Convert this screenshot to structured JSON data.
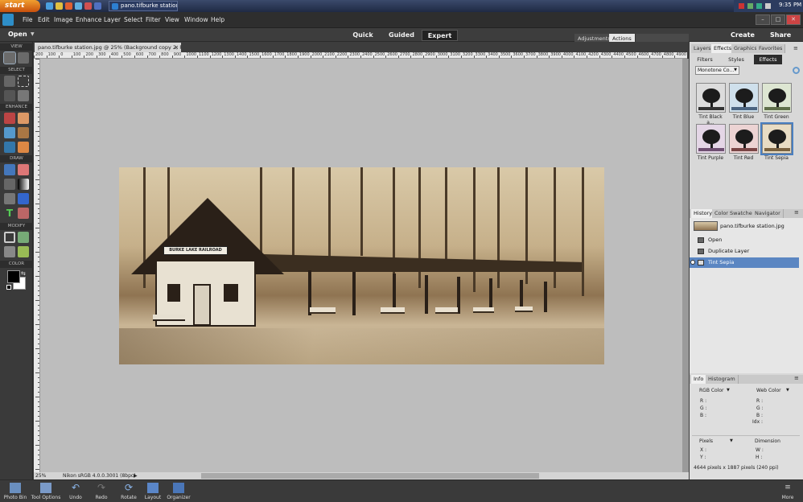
{
  "taskbar": {
    "start_label": "start",
    "task_button_label": "pano.tifburke station...",
    "clock": "9:35 PM"
  },
  "menubar": {
    "items": [
      "File",
      "Edit",
      "Image",
      "Enhance",
      "Layer",
      "Select",
      "Filter",
      "View",
      "Window",
      "Help"
    ]
  },
  "modebar": {
    "open_label": "Open",
    "modes": [
      "Quick",
      "Guided",
      "Expert"
    ],
    "active_mode": "Expert",
    "create_label": "Create",
    "share_label": "Share",
    "panel_tabs": [
      "Adjustments",
      "Actions"
    ]
  },
  "toolbox": {
    "sections": [
      "VIEW",
      "SELECT",
      "ENHANCE",
      "DRAW",
      "MODIFY",
      "COLOR"
    ],
    "foreground_color": "#000000",
    "background_color": "#ffffff"
  },
  "document": {
    "tab_title": "pano.tifburke station.jpg @ 25% (Background copy 2, RGB/8) *",
    "ruler_labels": [
      "200",
      "100",
      "0",
      "100",
      "200",
      "300",
      "400",
      "500",
      "600",
      "700",
      "800",
      "900",
      "1000",
      "1100",
      "1200",
      "1300",
      "1400",
      "1500",
      "1600",
      "1700",
      "1800",
      "1900",
      "2000",
      "2100",
      "2200",
      "2300",
      "2400",
      "2500",
      "2600",
      "2700",
      "2800",
      "2900",
      "3000",
      "3100",
      "3200",
      "3300",
      "3400",
      "3500",
      "3600",
      "3700",
      "3800",
      "3900",
      "4000",
      "4100",
      "4200",
      "4300",
      "4400",
      "4500",
      "4600",
      "4700",
      "4800",
      "4900"
    ],
    "zoom": "25%",
    "profile": "Nikon sRGB 4.0.0.3001 (8bpc)",
    "sign_text": "BURKE LAKE RAILROAD"
  },
  "panels": {
    "top_tabs": [
      "Layers",
      "Effects",
      "Graphics",
      "Favorites"
    ],
    "active_top_tab": "Effects",
    "sub_tabs": [
      "Filters",
      "Styles",
      "Effects"
    ],
    "active_sub_tab": "Effects",
    "effects_dropdown": "Monotone Co...",
    "effects": [
      {
        "label": "Tint Black a...",
        "tint": "#dcdcdc",
        "ground": "#333333"
      },
      {
        "label": "Tint Blue",
        "tint": "#cfe0ec",
        "ground": "#4a6480"
      },
      {
        "label": "Tint Green",
        "tint": "#dde6d2",
        "ground": "#5f6f4a"
      },
      {
        "label": "Tint Purple",
        "tint": "#e4d6e6",
        "ground": "#6f4f72"
      },
      {
        "label": "Tint Red",
        "tint": "#ecd3d3",
        "ground": "#7a4545"
      },
      {
        "label": "Tint Sepia",
        "tint": "#e8dcc4",
        "ground": "#7a6240"
      }
    ],
    "selected_effect": "Tint Sepia",
    "history_tabs": [
      "History",
      "Color Swatches",
      "Navigator"
    ],
    "history_items": [
      "pano.tifburke station.jpg",
      "Open",
      "Duplicate Layer",
      "Tint Sepia"
    ],
    "selected_history": "Tint Sepia",
    "info_tabs": [
      "Info",
      "Histogram"
    ],
    "info": {
      "rgb_mode": "RGB Color",
      "web_mode": "Web Color",
      "r": "R :",
      "g": "G :",
      "b": "B :",
      "wr": "R :",
      "wg": "G :",
      "wb": "B :",
      "idx": "Idx :",
      "units": "Pixels",
      "dimension": "Dimension",
      "x": "X :",
      "y": "Y :",
      "w": "W :",
      "h": "H :",
      "doc_size": "4644 pixels x 1887 pixels (240 ppi)"
    }
  },
  "bottombar": {
    "buttons": [
      "Photo Bin",
      "Tool Options",
      "Undo",
      "Redo",
      "Rotate",
      "Layout",
      "Organizer"
    ],
    "more_label": "More"
  }
}
